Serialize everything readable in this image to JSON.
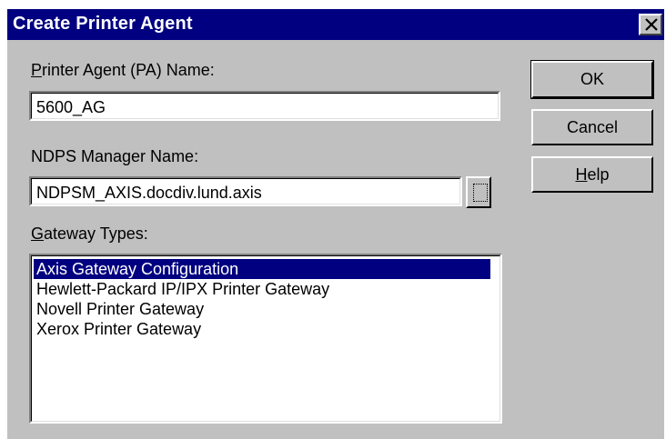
{
  "window": {
    "title": "Create Printer Agent",
    "close_icon": "close-x-icon"
  },
  "fields": {
    "pa_name": {
      "label_mnemonic": "P",
      "label_rest": "rinter Agent (PA) Name:",
      "value": "5600_AG"
    },
    "manager": {
      "label": "NDPS Manager Name:",
      "value": "NDPSM_AXIS.docdiv.lund.axis",
      "browse_icon": "browse-ellipsis-icon"
    }
  },
  "gateway": {
    "label_mnemonic": "G",
    "label_rest": "ateway Types:",
    "items": [
      "Axis Gateway Configuration",
      "Hewlett-Packard IP/IPX Printer Gateway",
      "Novell Printer Gateway",
      "Xerox Printer Gateway"
    ],
    "selected": "Axis Gateway Configuration"
  },
  "buttons": {
    "ok": "OK",
    "cancel": "Cancel",
    "help_mnemonic": "H",
    "help_rest": "elp"
  },
  "colors": {
    "titlebar": "#000080",
    "face": "#c0c0c0",
    "selection": "#000080"
  }
}
